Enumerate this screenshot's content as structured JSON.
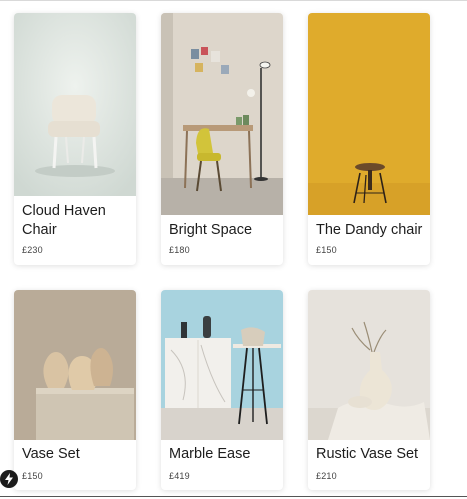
{
  "products": [
    {
      "name": "Cloud Haven Chair",
      "price": "£230",
      "image": "white tufted armchair on pale backdrop"
    },
    {
      "name": "Bright Space",
      "price": "£180",
      "image": "yellow chair at desk with floor lamp"
    },
    {
      "name": "The Dandy chair",
      "price": "£150",
      "image": "wooden stool on mustard background"
    },
    {
      "name": "Vase Set",
      "price": "£150",
      "image": "ceramic vases on stone block"
    },
    {
      "name": "Marble Ease",
      "price": "£419",
      "image": "marble cabinet and bar stool on blue wall"
    },
    {
      "name": "Rustic Vase Set",
      "price": "£210",
      "image": "cream vase with dried stems"
    }
  ],
  "icons": {
    "badge": "bolt-icon"
  }
}
